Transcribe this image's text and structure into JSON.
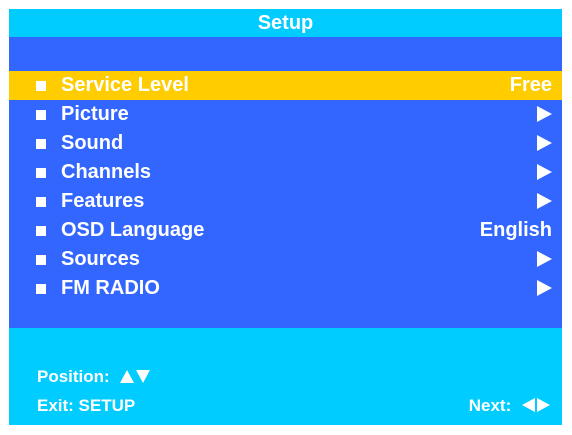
{
  "title": "Setup",
  "colors": {
    "title_bar": "#00ccff",
    "menu_background": "#3366ff",
    "selected_row": "#ffcc00",
    "text": "#ffffff"
  },
  "menu": {
    "items": [
      {
        "label": "Service Level",
        "value": "Free",
        "icon": "",
        "selected": true
      },
      {
        "label": "Picture",
        "value": "",
        "icon": "submenu-arrow-icon",
        "selected": false
      },
      {
        "label": "Sound",
        "value": "",
        "icon": "submenu-arrow-icon",
        "selected": false
      },
      {
        "label": "Channels",
        "value": "",
        "icon": "submenu-arrow-icon",
        "selected": false
      },
      {
        "label": "Features",
        "value": "",
        "icon": "submenu-arrow-icon",
        "selected": false
      },
      {
        "label": "OSD Language",
        "value": "English",
        "icon": "",
        "selected": false
      },
      {
        "label": "Sources",
        "value": "",
        "icon": "submenu-arrow-icon",
        "selected": false
      },
      {
        "label": "FM RADIO",
        "value": "",
        "icon": "submenu-arrow-icon",
        "selected": false
      }
    ]
  },
  "footer": {
    "position_label": "Position:",
    "position_icons": [
      "up-arrow-icon",
      "down-arrow-icon"
    ],
    "exit_label": "Exit: SETUP",
    "next_label": "Next:",
    "next_icons": [
      "left-arrow-icon",
      "right-arrow-icon"
    ]
  }
}
